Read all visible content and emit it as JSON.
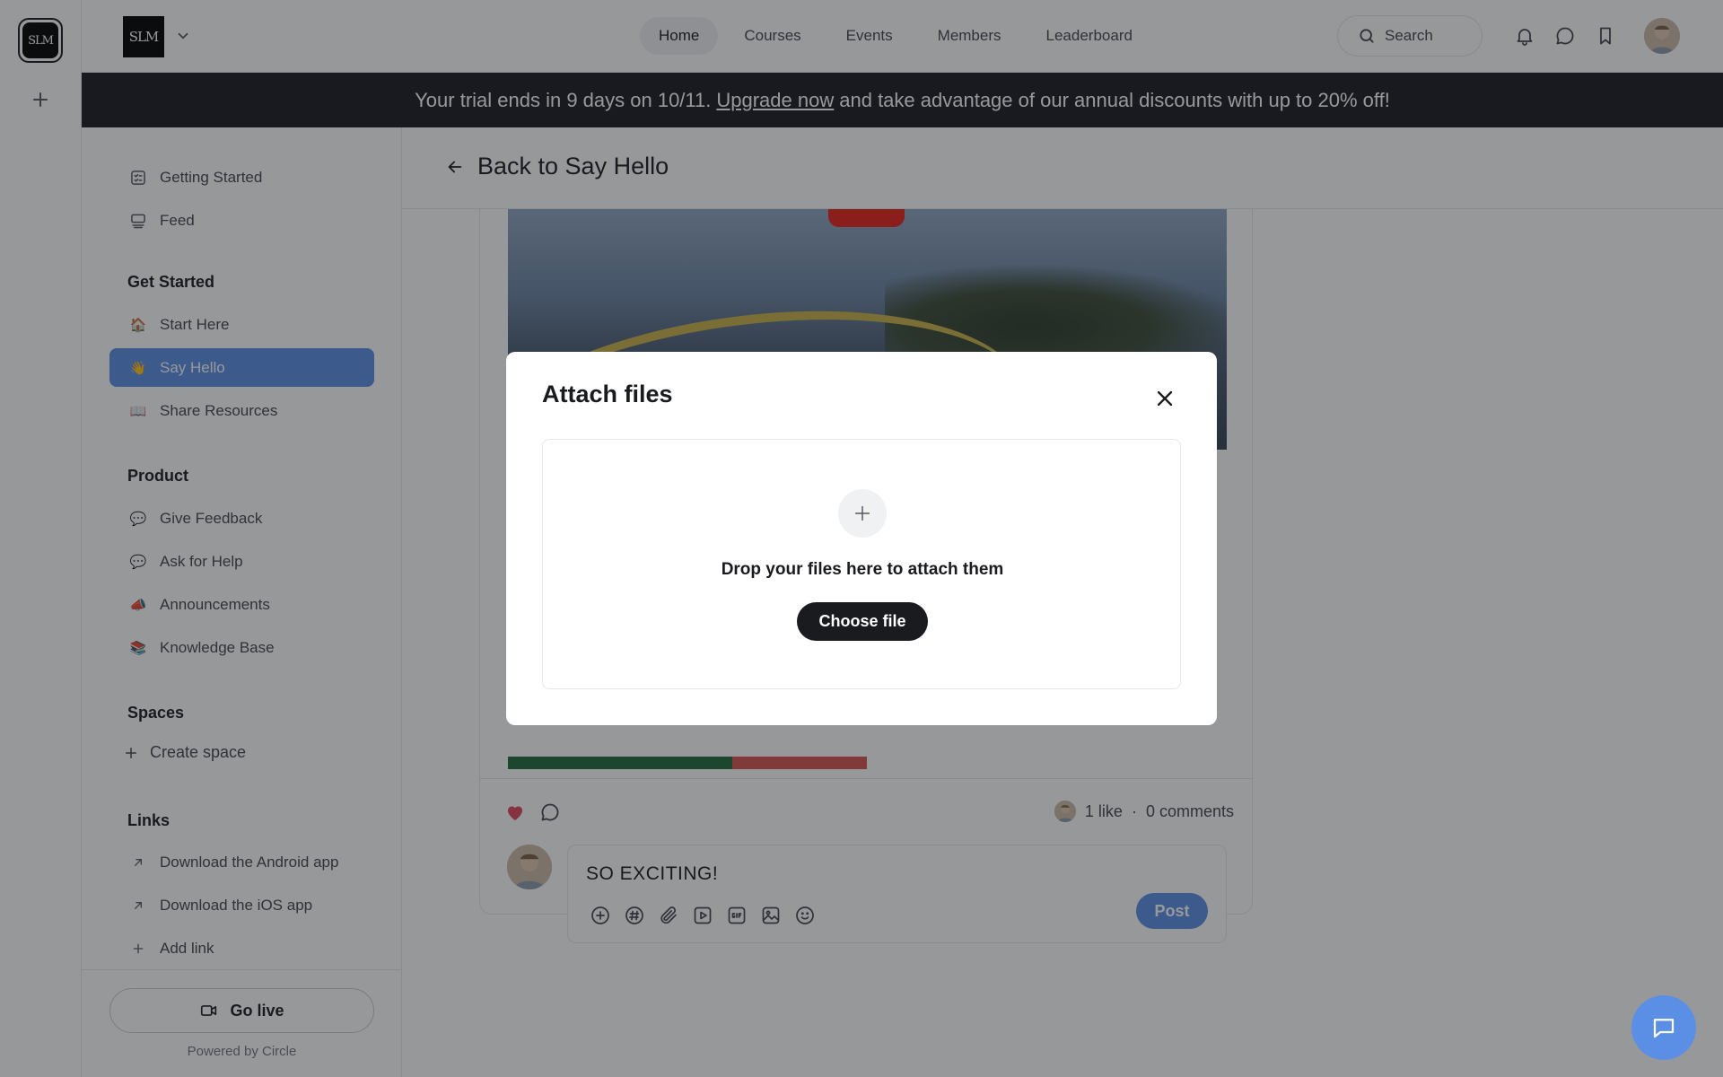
{
  "rail": {
    "logo_text": "SLM"
  },
  "header": {
    "brand_text": "SLM",
    "nav": [
      {
        "label": "Home",
        "active": true
      },
      {
        "label": "Courses",
        "active": false
      },
      {
        "label": "Events",
        "active": false
      },
      {
        "label": "Members",
        "active": false
      },
      {
        "label": "Leaderboard",
        "active": false
      }
    ],
    "search_label": "Search"
  },
  "banner": {
    "text_before": "Your trial ends in 9 days on 10/11.",
    "link_text": "Upgrade now",
    "text_after": "and take advantage of our annual discounts with up to 20% off!"
  },
  "sidebar": {
    "top_items": [
      {
        "label": "Getting Started",
        "icon": "checklist-icon"
      },
      {
        "label": "Feed",
        "icon": "feed-icon"
      }
    ],
    "groups": [
      {
        "heading": "Get Started",
        "items": [
          {
            "label": "Start Here",
            "emoji": "🏠",
            "active": false
          },
          {
            "label": "Say Hello",
            "emoji": "👋",
            "active": true
          },
          {
            "label": "Share Resources",
            "emoji": "📖",
            "active": false
          }
        ]
      },
      {
        "heading": "Product",
        "items": [
          {
            "label": "Give Feedback",
            "emoji": "💬",
            "active": false
          },
          {
            "label": "Ask for Help",
            "emoji": "💬",
            "active": false
          },
          {
            "label": "Announcements",
            "emoji": "📣",
            "active": false
          },
          {
            "label": "Knowledge Base",
            "emoji": "📚",
            "active": false
          }
        ]
      }
    ],
    "spaces_heading": "Spaces",
    "create_space_label": "Create space",
    "links_heading": "Links",
    "links": [
      {
        "label": "Download the Android app",
        "icon": "arrow-up-right-icon"
      },
      {
        "label": "Download the iOS app",
        "icon": "arrow-up-right-icon"
      },
      {
        "label": "Add link",
        "icon": "plus-icon"
      }
    ],
    "go_live_label": "Go live",
    "powered_by": "Powered by Circle"
  },
  "main": {
    "back_label": "Back to Say Hello",
    "post": {
      "likes_text": "1 like",
      "separator": "·",
      "comments_text": "0 comments",
      "composer_text": "SO EXCITING!",
      "post_button": "Post"
    }
  },
  "modal": {
    "title": "Attach files",
    "drop_text": "Drop your files here to attach them",
    "choose_button": "Choose file"
  },
  "colors": {
    "accent": "#5b8fe6",
    "dark": "#191b1f",
    "heart": "#e2455b"
  }
}
